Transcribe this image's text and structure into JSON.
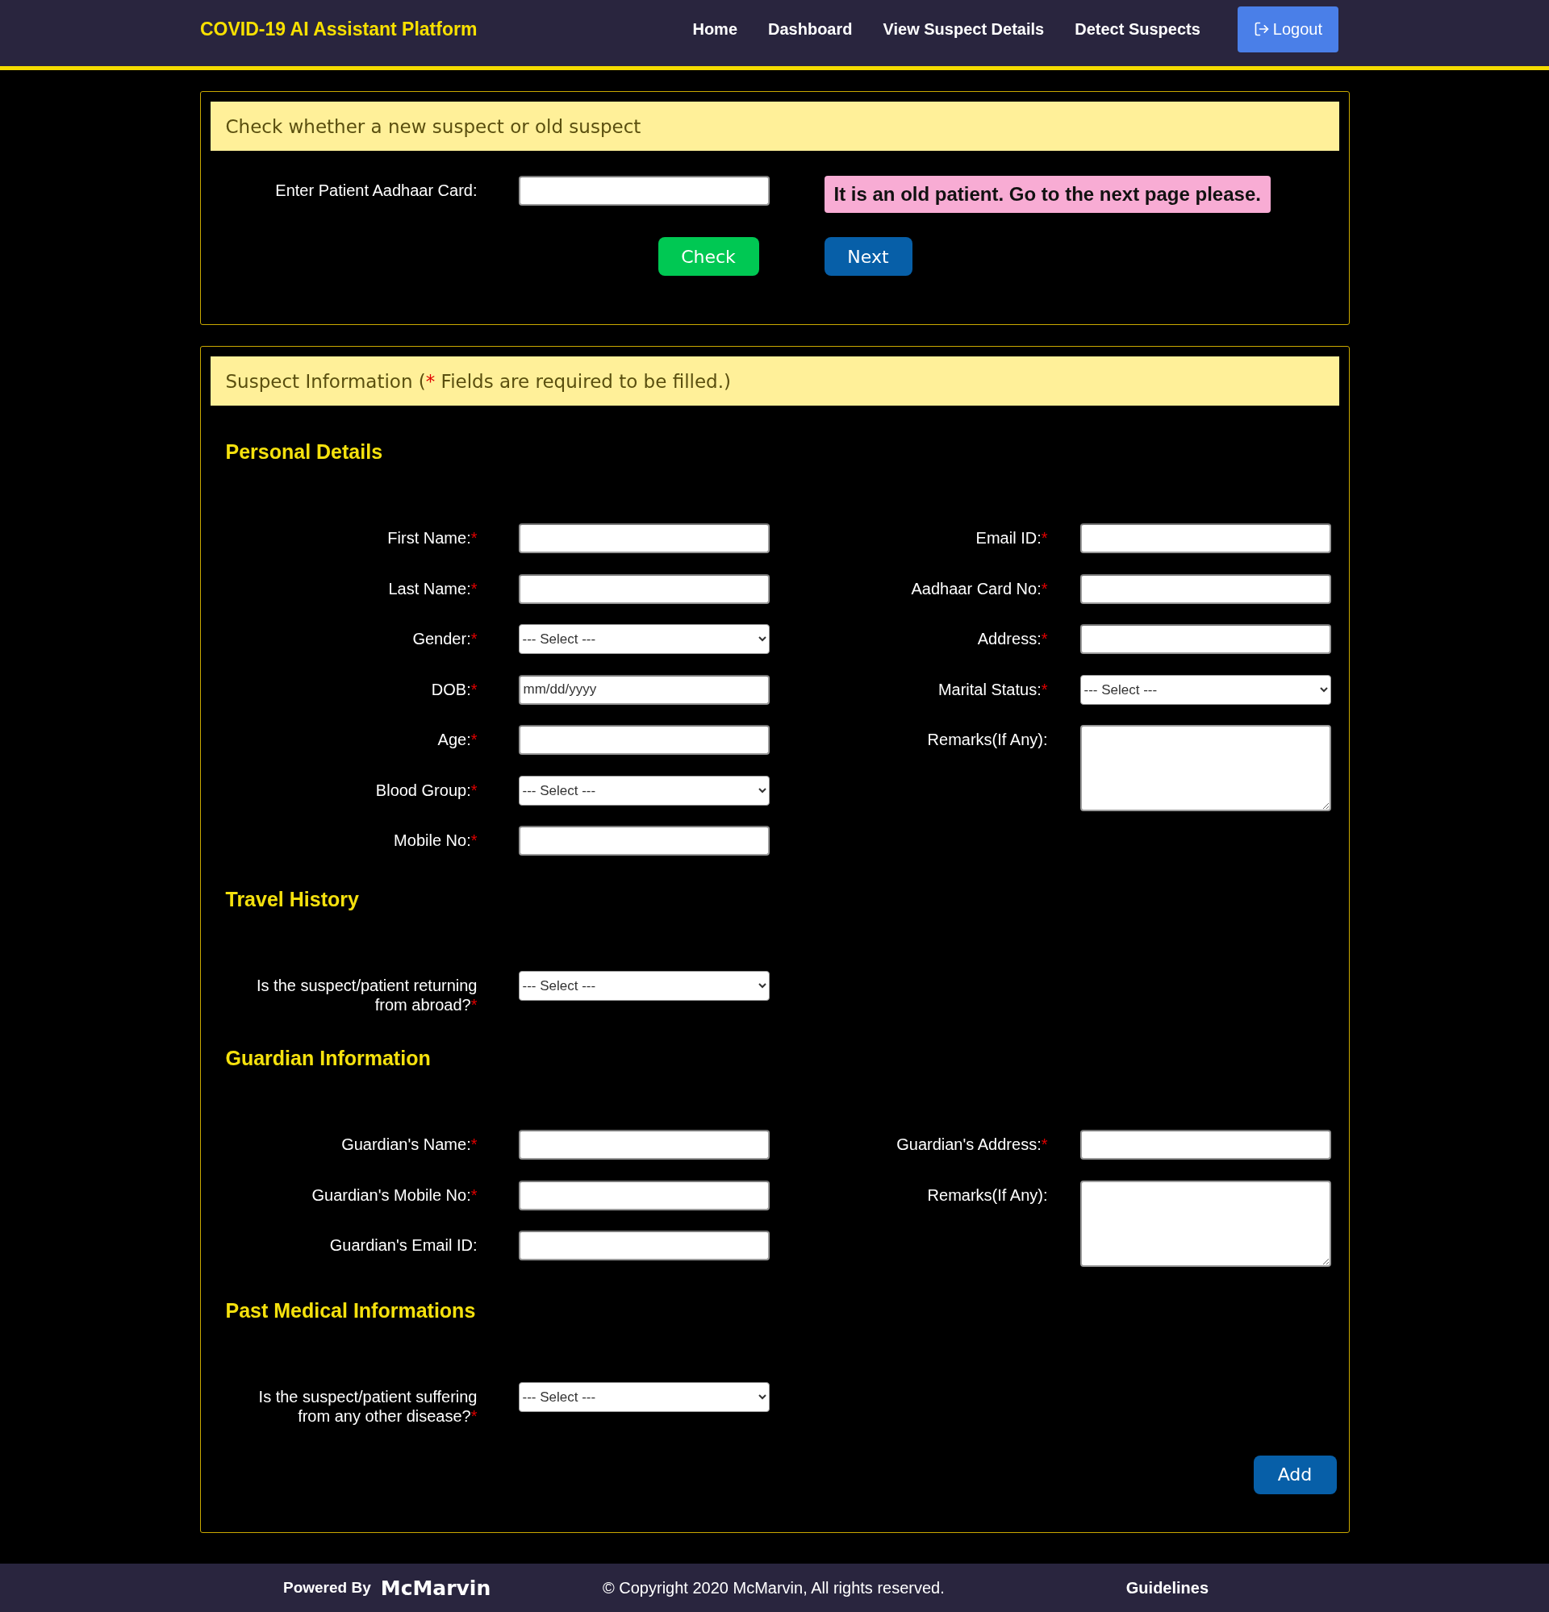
{
  "brand": "COVID-19 AI Assistant Platform",
  "nav": [
    {
      "label": "Home"
    },
    {
      "label": "Dashboard"
    },
    {
      "label": "View Suspect Details"
    },
    {
      "label": "Detect Suspects"
    }
  ],
  "logout": "Logout",
  "required_mark": "*",
  "check_card": {
    "title": "Check whether a new suspect or old suspect",
    "label": "Enter Patient Aadhaar Card:",
    "message": "It is an old patient. Go to the next page please.",
    "check_button": "Check",
    "next_button": "Next"
  },
  "form_card": {
    "title_before": "Suspect Information (",
    "title_after": " Fields are required to be filled.)",
    "sections": [
      {
        "title": "Personal Details",
        "left": [
          {
            "label": "First Name:",
            "kind": "input",
            "required": true
          },
          {
            "label": "Last Name:",
            "kind": "input",
            "required": true
          },
          {
            "label": "Gender:",
            "kind": "select",
            "required": true,
            "value": "--- Select ---"
          },
          {
            "label": "DOB:",
            "kind": "date",
            "required": true,
            "placeholder": "mm/dd/yyyy"
          },
          {
            "label": "Age:",
            "kind": "input",
            "required": true
          },
          {
            "label": "Blood Group:",
            "kind": "select",
            "required": true,
            "value": "--- Select ---"
          },
          {
            "label": "Mobile No:",
            "kind": "input",
            "required": true
          }
        ],
        "right": [
          {
            "label": "Email ID:",
            "kind": "input",
            "required": true
          },
          {
            "label": "Aadhaar Card No:",
            "kind": "input",
            "required": true
          },
          {
            "label": "Address:",
            "kind": "input",
            "required": true
          },
          {
            "label": "Marital Status:",
            "kind": "select",
            "required": true,
            "value": "--- Select ---"
          },
          {
            "label": "Remarks(If Any):",
            "kind": "textarea",
            "required": false
          }
        ]
      },
      {
        "title": "Travel History",
        "left": [
          {
            "label": "Is the suspect/patient returning from abroad?",
            "kind": "select",
            "required": true,
            "value": "--- Select ---"
          }
        ]
      },
      {
        "title": "Guardian Information",
        "left": [
          {
            "label": "Guardian's Name:",
            "kind": "input",
            "required": true
          },
          {
            "label": "Guardian's Mobile No:",
            "kind": "input",
            "required": true
          },
          {
            "label": "Guardian's Email ID:",
            "kind": "input",
            "required": false
          }
        ],
        "right": [
          {
            "label": "Guardian's Address:",
            "kind": "input",
            "required": true
          },
          {
            "label": "Remarks(If Any):",
            "kind": "textarea",
            "required": false
          }
        ]
      },
      {
        "title": "Past Medical Informations",
        "left": [
          {
            "label": "Is the suspect/patient suffering from any other disease?",
            "kind": "select",
            "required": true,
            "value": "--- Select ---"
          }
        ]
      }
    ],
    "add_button": "Add"
  },
  "footer": {
    "powered_by": "Powered By",
    "logo": "McMarvin",
    "copyright": "© Copyright 2020 McMarvin, All rights reserved.",
    "link": "Guidelines"
  }
}
